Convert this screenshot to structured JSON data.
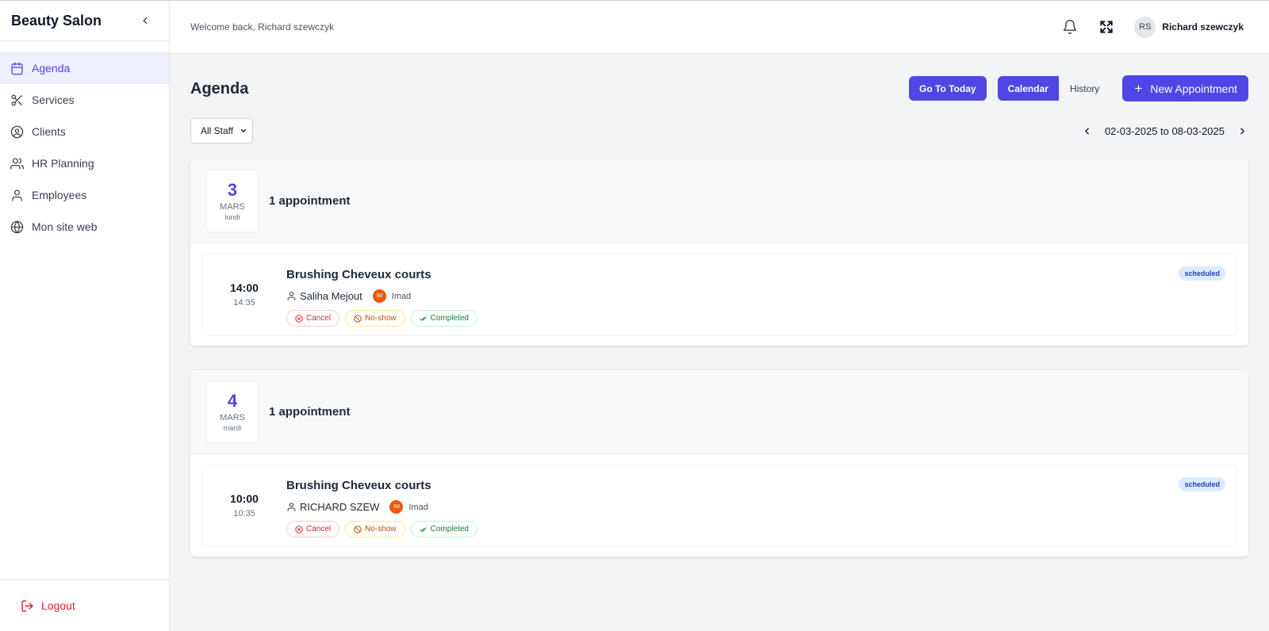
{
  "sidebar": {
    "brand": "Beauty Salon",
    "items": [
      {
        "label": "Agenda",
        "icon": "calendar-icon",
        "active": true
      },
      {
        "label": "Services",
        "icon": "scissors-icon"
      },
      {
        "label": "Clients",
        "icon": "user-circle-icon"
      },
      {
        "label": "HR Planning",
        "icon": "users-icon"
      },
      {
        "label": "Employees",
        "icon": "user-icon"
      },
      {
        "label": "Mon site web",
        "icon": "globe-icon"
      }
    ],
    "logout": "Logout"
  },
  "header": {
    "welcome": "Welcome back, Richard szewczyk",
    "user_initials": "RS",
    "user_name": "Richard szewczyk"
  },
  "page": {
    "title": "Agenda",
    "go_today": "Go To Today",
    "view_calendar": "Calendar",
    "view_history": "History",
    "new_appointment": "New Appointment",
    "staff_filter": "All Staff",
    "date_range": "02-03-2025 to 08-03-2025"
  },
  "days": [
    {
      "day": "3",
      "month": "MARS",
      "weekday": "lundi",
      "count": "1 appointment",
      "appointments": [
        {
          "start": "14:00",
          "end": "14:35",
          "service": "Brushing Cheveux courts",
          "client": "Saliha Mejout",
          "staff_initials": "IM",
          "staff": "Imad",
          "status": "scheduled",
          "cancel": "Cancel",
          "noshow": "No-show",
          "completed": "Completed"
        }
      ]
    },
    {
      "day": "4",
      "month": "MARS",
      "weekday": "mardi",
      "count": "1 appointment",
      "appointments": [
        {
          "start": "10:00",
          "end": "10:35",
          "service": "Brushing Cheveux courts",
          "client": "RICHARD SZEW",
          "staff_initials": "IM",
          "staff": "Imad",
          "status": "scheduled",
          "cancel": "Cancel",
          "noshow": "No-show",
          "completed": "Completed"
        }
      ]
    }
  ],
  "colors": {
    "accent": "#4f46e5",
    "danger": "#dc2626",
    "staff_badge": "#ea580c"
  }
}
